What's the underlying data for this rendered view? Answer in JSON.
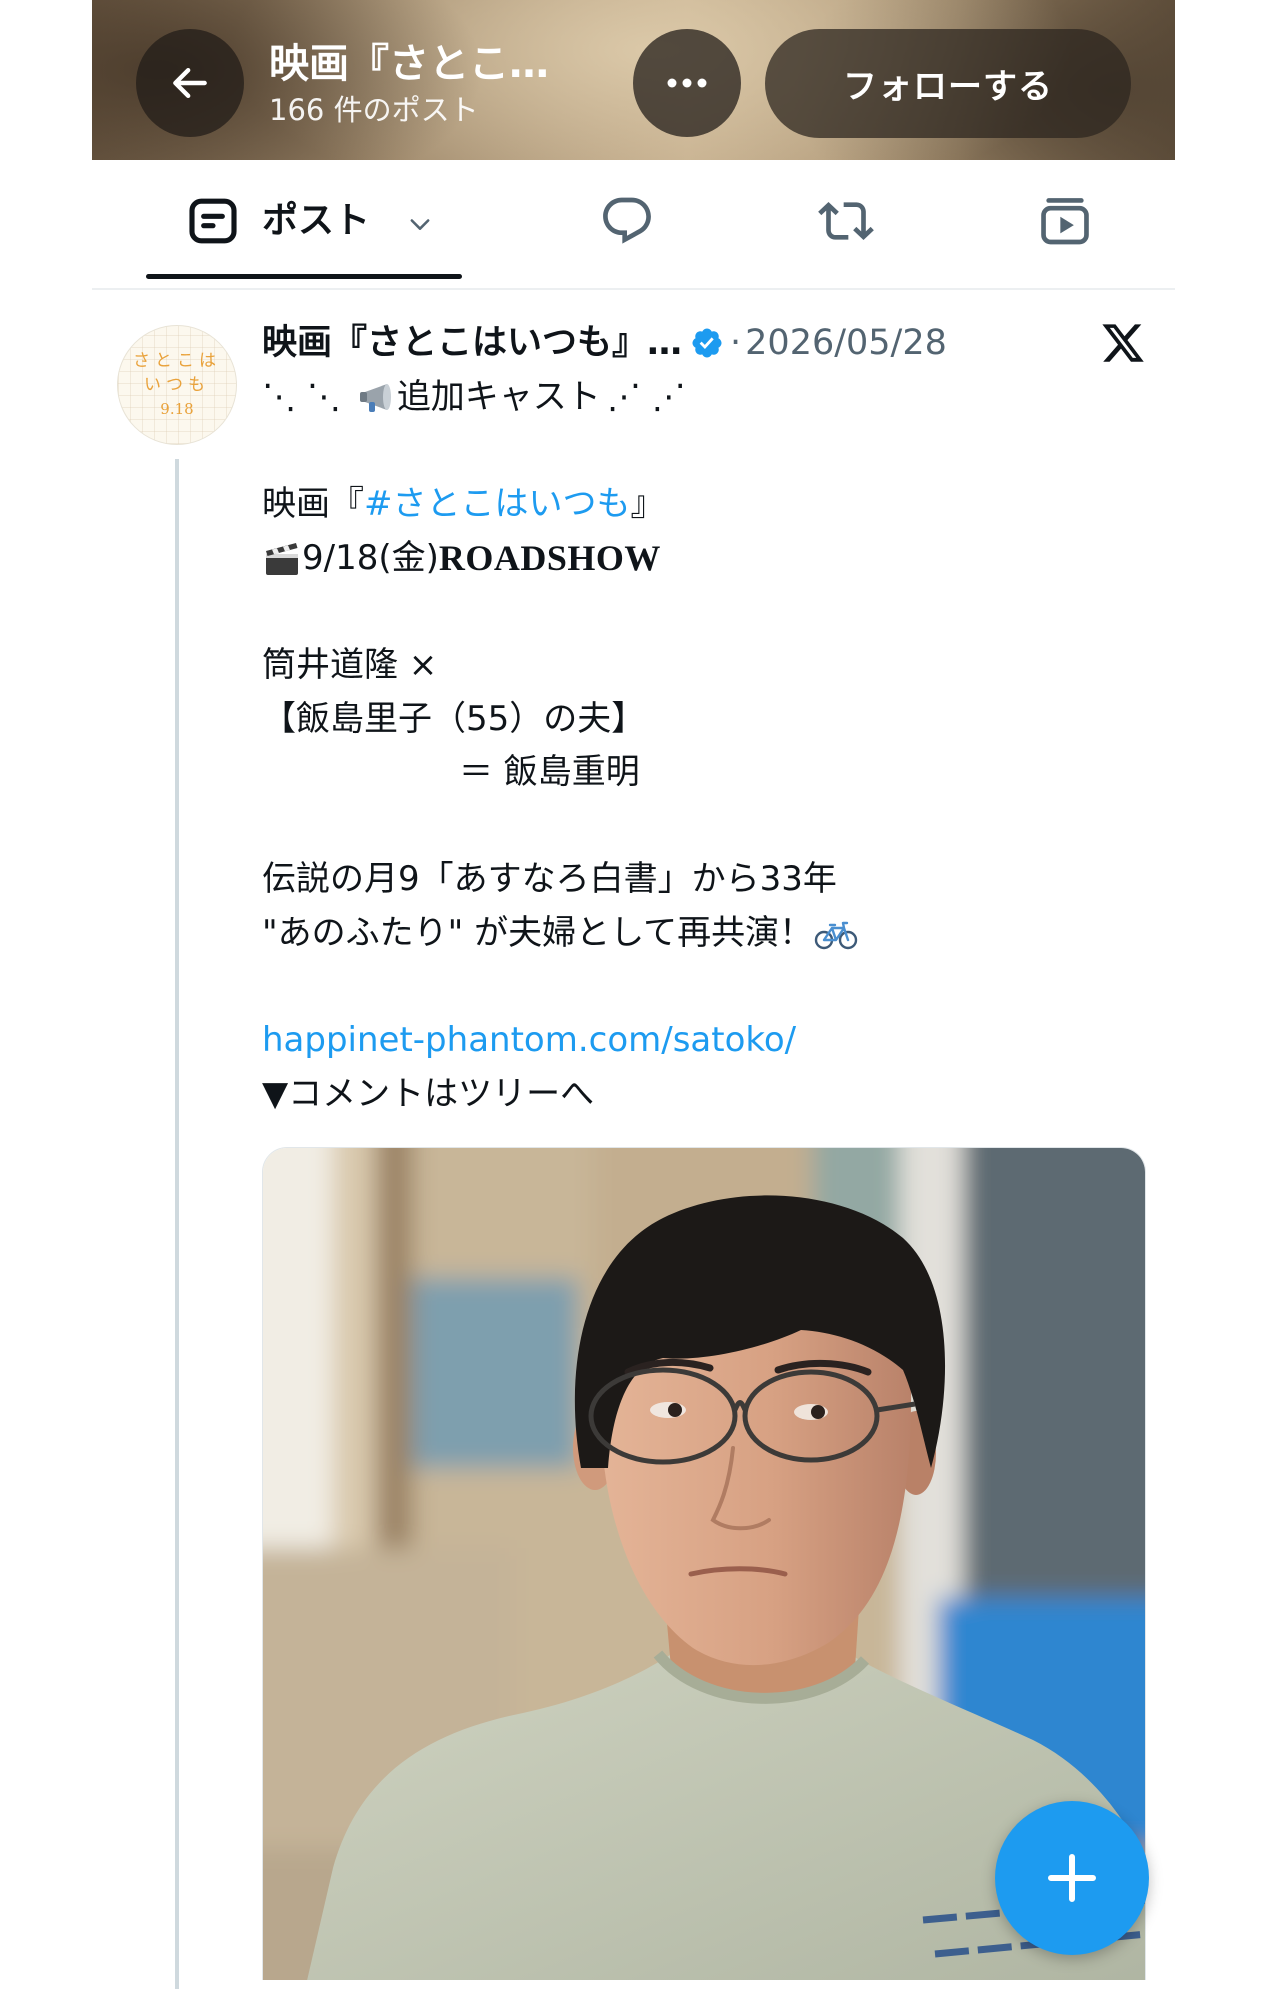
{
  "colors": {
    "accent": "#1d9bf0",
    "text": "#0f1419",
    "secondary": "#536471",
    "divider": "#eceff1",
    "thread_line": "#cfd9de",
    "avatar_text": "#e9a23b"
  },
  "header": {
    "back_icon": "arrow-left-icon",
    "title": "映画『さとこ…",
    "post_count": "166 件のポスト",
    "more_icon": "more-horizontal-icon",
    "follow_label": "フォローする"
  },
  "tabs": [
    {
      "id": "posts",
      "label": "ポスト",
      "icon": "posts-icon",
      "dropdown_icon": "chevron-down-icon",
      "active": true
    },
    {
      "id": "replies",
      "icon": "reply-icon",
      "active": false
    },
    {
      "id": "reposts",
      "icon": "repost-icon",
      "active": false
    },
    {
      "id": "media",
      "icon": "media-icon",
      "active": false
    }
  ],
  "post": {
    "avatar": {
      "line1": "さとこは",
      "line2": "いつも",
      "line3": "9.18"
    },
    "author_name": "映画『さとこはいつも』…",
    "verified": true,
    "verified_icon": "verified-badge-icon",
    "separator": "·",
    "date": "2026/05/28",
    "platform_icon": "x-logo-icon",
    "body": {
      "deco_left": "⋱ ⋱",
      "megaphone_emoji": "megaphone-emoji",
      "announcement": "追加キャスト",
      "deco_right": "⋰ ⋰",
      "title_prefix": "映画『",
      "hashtag": "#さとこはいつも",
      "title_suffix": "』",
      "clapper_emoji": "clapper-board-emoji",
      "release_date": "9/18(金)",
      "roadshow": "ROADSHOW",
      "actor_line": "筒井道隆 ×",
      "role_line": "【飯島里子（55）の夫】",
      "character_line": "＝ 飯島重明",
      "legend_line": "伝説の月9「あすなろ白書」から33年",
      "reunion_line": "\"あのふたり\" が夫婦として再共演！",
      "bicycle_emoji": "bicycle-emoji",
      "link": "happinet-phantom.com/satoko/",
      "comment_note": "▼コメントはツリーへ"
    },
    "media": {
      "type": "photo"
    }
  },
  "fab": {
    "icon": "compose-plus-icon"
  }
}
